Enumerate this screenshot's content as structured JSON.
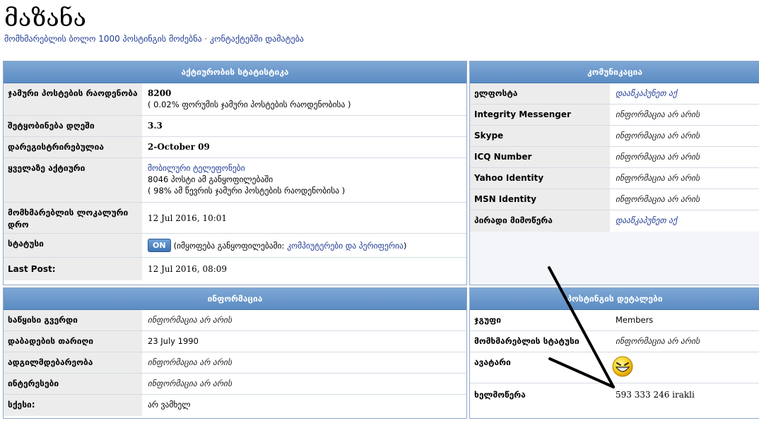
{
  "page": {
    "title": "მაზანა",
    "sub_link_1": "მომხმარებლის ბოლო 1000 პოსტინგის მოძებნა",
    "sub_sep": " · ",
    "sub_link_2": "კონტაქტებში დამატება"
  },
  "activity": {
    "header": "აქტიურობის სტატისტიკა",
    "total_posts_label": "ჯამური პოსტების რაოდენობა",
    "total_posts_value": "8200",
    "total_posts_note": "( 0.02% ფორუმის ჯამური პოსტების რაოდენობისა )",
    "per_day_label": "შეტყობინება დღეში",
    "per_day_value": "3.3",
    "registered_label": "დარეგისტრირებულია",
    "registered_value": "2-October 09",
    "most_active_label": "ყველაზე აქტიური",
    "most_active_link": "მობილური ტელეფონები",
    "most_active_posts": "8046 პოსტი ამ განყოფილებაში",
    "most_active_note": "( 98% ამ წევრის ჯამური პოსტების რაოდენობისა )",
    "local_time_label": "მომხმარებლის ლოკალური დრო",
    "local_time_value": "12 Jul 2016, 10:01",
    "status_label": "სტატუსი",
    "status_badge": "ON",
    "status_text_prefix": "(იმყოფება განყოფილებაში:",
    "status_link": "კომპიუტერები და პერიფერია",
    "status_text_suffix": ")",
    "last_post_label": "Last Post:",
    "last_post_value": "12 Jul 2016, 08:09"
  },
  "communication": {
    "header": "კომუნიკაცია",
    "rows": [
      {
        "label": "ელფოსტა",
        "value": "დააწკაპუნეთ აქ",
        "link": true
      },
      {
        "label": "Integrity Messenger",
        "value": "ინფორმაცია არ არის",
        "link": false
      },
      {
        "label": "Skype",
        "value": "ინფორმაცია არ არის",
        "link": false
      },
      {
        "label": "ICQ Number",
        "value": "ინფორმაცია არ არის",
        "link": false
      },
      {
        "label": "Yahoo Identity",
        "value": "ინფორმაცია არ არის",
        "link": false
      },
      {
        "label": "MSN Identity",
        "value": "ინფორმაცია არ არის",
        "link": false
      },
      {
        "label": "პირადი მიმოწერა",
        "value": "დააწკაპუნეთ აქ",
        "link": true
      }
    ]
  },
  "information": {
    "header": "ინფორმაცია",
    "rows": [
      {
        "label": "საწყისი გვერდი",
        "value": "ინფორმაცია არ არის",
        "italic": true
      },
      {
        "label": "დაბადების თარიღი",
        "value": "23 July 1990",
        "italic": false
      },
      {
        "label": "ადგილმდებარეობა",
        "value": "ინფორმაცია არ არის",
        "italic": true
      },
      {
        "label": "ინტერესები",
        "value": "ინფორმაცია არ არის",
        "italic": true
      },
      {
        "label": "სქესი:",
        "value": "არ ვამხელ",
        "italic": false
      }
    ]
  },
  "posting": {
    "header": "პოსტინგის დეტალები",
    "group_label": "ჯგუფი",
    "group_value": "Members",
    "user_status_label": "მომხმარებლის სტატუსი",
    "user_status_value": "ინფორმაცია არ არის",
    "avatar_label": "ავატარი",
    "signature_label": "ხელმოწერა",
    "signature_value": "593 333 246 irakli"
  }
}
